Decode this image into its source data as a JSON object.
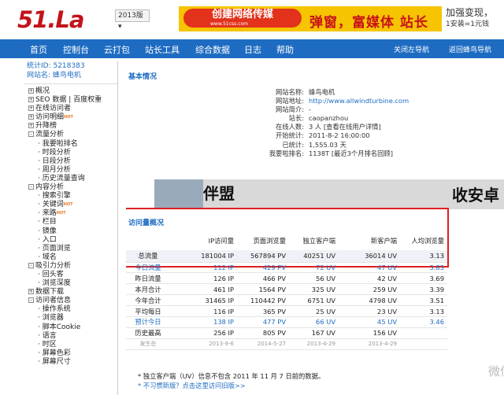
{
  "header": {
    "logo": "51.La",
    "version": "2013版 ▾",
    "ad_left_pill": "创建网络传媒",
    "ad_left_url": "www.51css.com",
    "ad_left_big": "弹窗，富媒体 站长首选",
    "ad_right_line1": "加强变现，",
    "ad_right_line2": "1安装=1元钱"
  },
  "nav": {
    "items": [
      "首页",
      "控制台",
      "云打包",
      "站长工具",
      "综合数据",
      "日志",
      "帮助"
    ],
    "right1": "关闭左导航",
    "right2": "返回蜂鸟导航"
  },
  "sidebar": {
    "stat_id": "统计ID: 5218383",
    "site_name": "网站名: 蜂鸟电机",
    "items": [
      "概况",
      "SEO 数据 | 百度权重",
      "在线访问者",
      "访问明细",
      "升降榜",
      "流量分析",
      "我要啦排名",
      "时段分析",
      "日段分析",
      "周月分析",
      "历史流量查询",
      "内容分析",
      "搜索引擎",
      "关键词",
      "来路",
      "栏目",
      "镜像",
      "入口",
      "页面浏览",
      "域名",
      "吸引力分析",
      "回头客",
      "浏览深度",
      "数据下载",
      "访问者信息",
      "操作系统",
      "浏览器",
      "脚本Cookie",
      "语言",
      "时区",
      "屏幕色彩",
      "屏幕尺寸"
    ],
    "hot": "HOT"
  },
  "basic": {
    "title": "基本情况",
    "rows": [
      [
        "网站名称:",
        "蜂鸟电机"
      ],
      [
        "网站地址:",
        "http://www.allwindturbine.com"
      ],
      [
        "网站简介:",
        "-"
      ],
      [
        "站长:",
        "caopanzhou"
      ],
      [
        "在线人数:",
        "3 人 [查看在线用户详情]"
      ],
      [
        "开始统计:",
        "2011-8-2 16:00:00"
      ],
      [
        "已统计:",
        "1,555.03 天"
      ],
      [
        "我要啦排名:",
        "1138T [最近3个月排名回顾]"
      ]
    ]
  },
  "banner": {
    "left": "伴盟",
    "right": "收安卓"
  },
  "visit": {
    "title": "访问量概况",
    "headers": [
      "",
      "IP访问量",
      "页面浏览量",
      "独立客户端",
      "新客户端",
      "人均浏览量"
    ],
    "rows": [
      [
        "总流量",
        "181004 IP",
        "567894 PV",
        "40251 UV",
        "36014 UV",
        "3.13"
      ],
      [
        "今日流量",
        "112 IP",
        "429 PV",
        "72 UV",
        "47 UV",
        "3.83"
      ],
      [
        "昨日流量",
        "126 IP",
        "466 PV",
        "56 UV",
        "42 UV",
        "3.69"
      ],
      [
        "本月合计",
        "461 IP",
        "1564 PV",
        "325 UV",
        "259 UV",
        "3.39"
      ],
      [
        "今年合计",
        "31465 IP",
        "110442 PV",
        "6751 UV",
        "4798 UV",
        "3.51"
      ],
      [
        "平均每日",
        "116 IP",
        "365 PV",
        "25 UV",
        "23 UV",
        "3.13"
      ],
      [
        "预计今日",
        "138 IP",
        "477 PV",
        "66 UV",
        "45 UV",
        "3.46"
      ],
      [
        "历史最高",
        "256 IP",
        "805 PV",
        "167 UV",
        "156 UV",
        ""
      ]
    ],
    "peak_dates": [
      "发生在",
      "2013-9-6",
      "2014-5-27",
      "2013-4-29",
      "2013-4-29"
    ]
  },
  "notes": {
    "line1": "* 独立客户端（UV）信息不包含 2011 年 11 月 7 日前的数据。",
    "line2": "* 不习惯新版？点击这里访问旧版>>"
  },
  "watermark": "微信号: benyxw"
}
